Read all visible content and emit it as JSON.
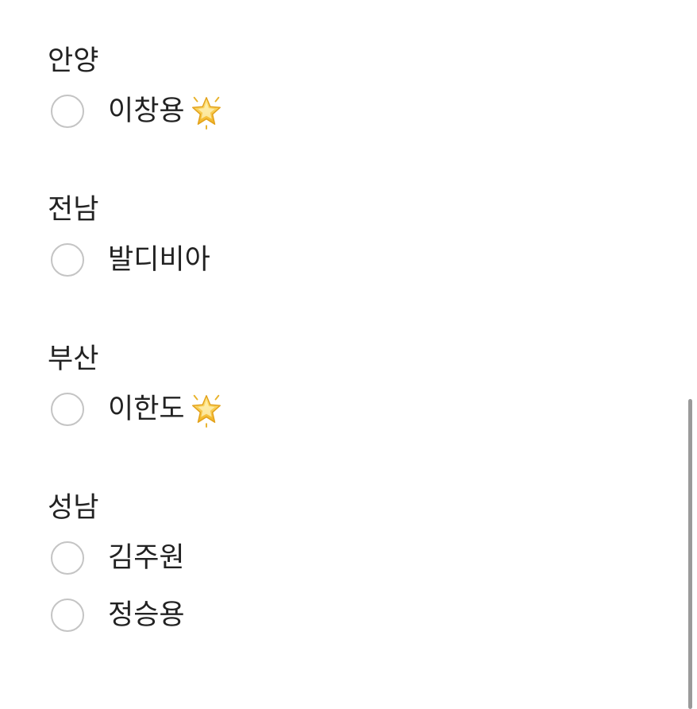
{
  "groups": [
    {
      "title": "안양",
      "options": [
        {
          "label": "이창용",
          "icon": "glowing-star-icon"
        }
      ]
    },
    {
      "title": "전남",
      "options": [
        {
          "label": "발디비아"
        }
      ]
    },
    {
      "title": "부산",
      "options": [
        {
          "label": "이한도",
          "icon": "glowing-star-icon"
        }
      ]
    },
    {
      "title": "성남",
      "options": [
        {
          "label": "김주원"
        },
        {
          "label": "정승용"
        }
      ]
    }
  ],
  "colors": {
    "text": "#222222",
    "radio_border": "#c4c4c4",
    "star_fill": "#f5c542",
    "scrollbar": "#9a9a9a"
  }
}
